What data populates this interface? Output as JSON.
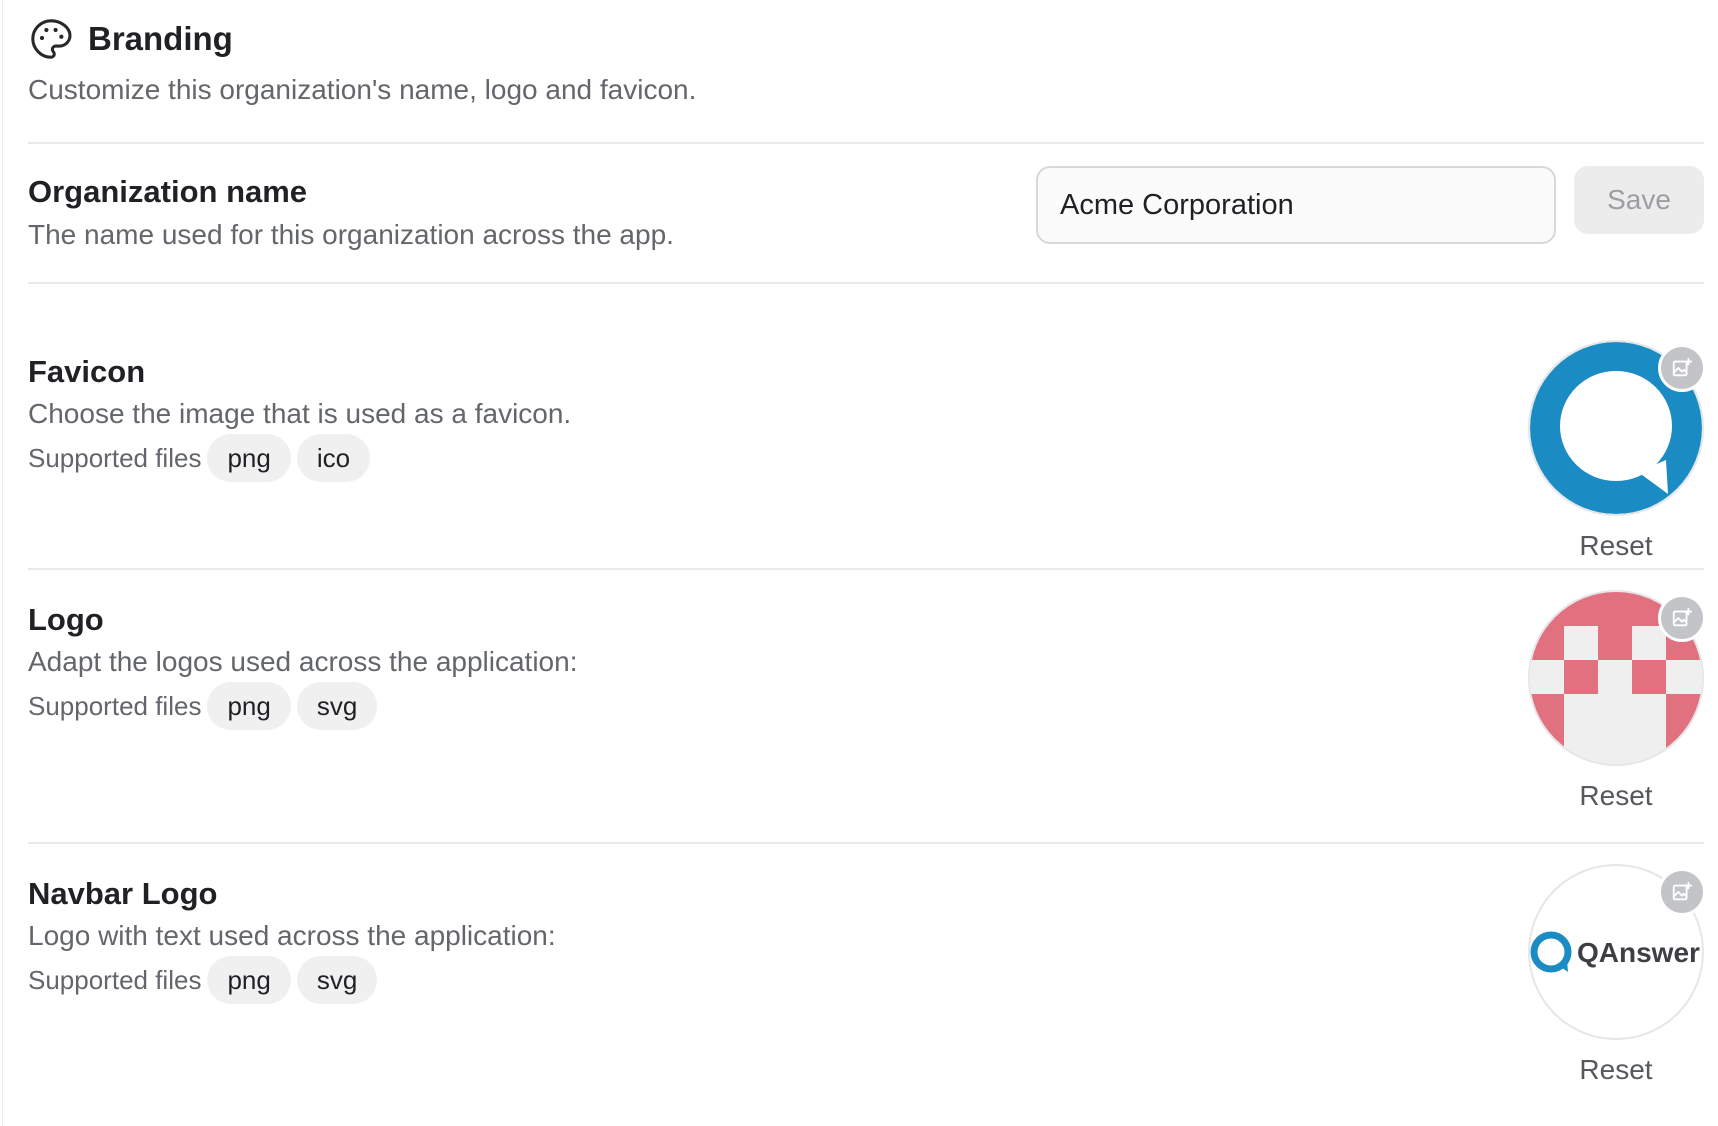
{
  "header": {
    "icon": "palette-icon",
    "title": "Branding",
    "subtitle": "Customize this organization's name, logo and favicon."
  },
  "org_name": {
    "title": "Organization name",
    "description": "The name used for this organization across the app.",
    "input_value": "Acme Corporation",
    "save_label": "Save"
  },
  "favicon": {
    "title": "Favicon",
    "description": "Choose the image that is used as a favicon.",
    "supported_label": "Supported files",
    "formats": [
      "png",
      "ico"
    ],
    "edit_icon": "image-edit-icon",
    "reset_label": "Reset"
  },
  "logo": {
    "title": "Logo",
    "description": "Adapt the logos used across the application:",
    "supported_label": "Supported files",
    "formats": [
      "png",
      "svg"
    ],
    "edit_icon": "image-edit-icon",
    "reset_label": "Reset"
  },
  "navbar_logo": {
    "title": "Navbar Logo",
    "description": "Logo with text used across the application:",
    "supported_label": "Supported files",
    "formats": [
      "png",
      "svg"
    ],
    "edit_icon": "image-edit-icon",
    "reset_label": "Reset",
    "preview_text": "QAnswer"
  },
  "colors": {
    "favicon_blue": "#1b8cc3",
    "logo_pink": "#e1717f",
    "logo_light": "#efefef"
  }
}
